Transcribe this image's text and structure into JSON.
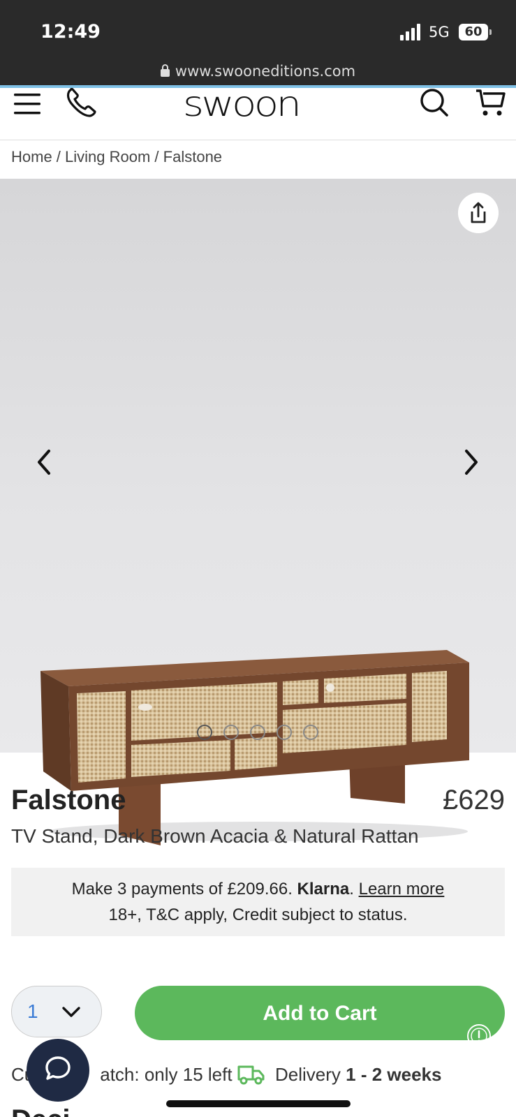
{
  "status_bar": {
    "time": "12:49",
    "network": "5G",
    "battery": "60"
  },
  "browser": {
    "url": "www.swooneditions.com"
  },
  "header": {
    "logo": "SWOON"
  },
  "breadcrumb": [
    "Home",
    "Living Room",
    "Falstone"
  ],
  "breadcrumb_separator": " / ",
  "gallery": {
    "image_count": 5,
    "active_index": 0
  },
  "product": {
    "name": "Falstone",
    "price": "£629",
    "subtitle": "TV Stand, Dark Brown Acacia & Natural Rattan"
  },
  "klarna": {
    "line1_prefix": "Make 3 payments of £209.66. ",
    "brand": "Klarna",
    "line1_dot": ". ",
    "learn_more": "Learn more",
    "line2": "18+, T&C apply, Credit subject to status."
  },
  "purchase": {
    "quantity": "1",
    "add_to_cart": "Add to Cart",
    "stock_prefix": "Cu",
    "stock_text": "atch: only 15 left",
    "delivery_label": "Delivery ",
    "delivery_value": "1 - 2 weeks"
  },
  "next_section_peek": "Deci",
  "colors": {
    "accent_green": "#5cb85c",
    "chat_navy": "#1f2a44",
    "quantity_blue": "#3a7bd5"
  },
  "icons": [
    "menu-icon",
    "phone-icon",
    "search-icon",
    "cart-icon",
    "share-icon",
    "chevron-left-icon",
    "chevron-right-icon",
    "chevron-down-icon",
    "truck-icon",
    "chat-icon",
    "alert-icon"
  ]
}
